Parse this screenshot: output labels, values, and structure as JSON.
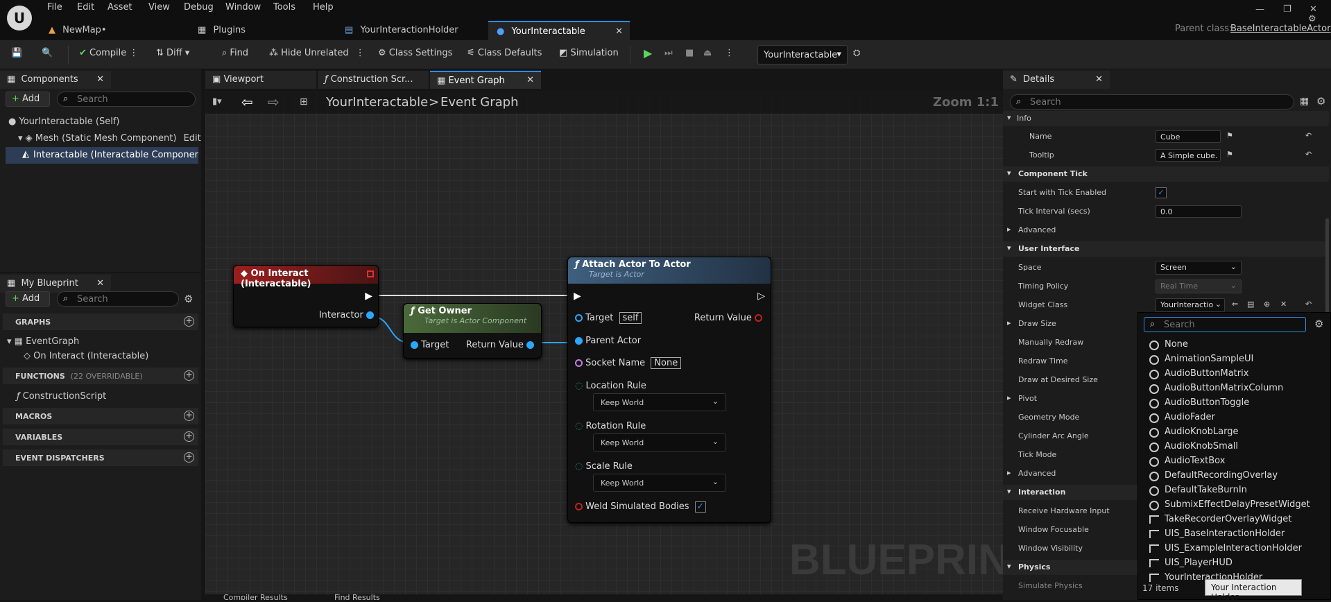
{
  "menu": [
    "File",
    "Edit",
    "Asset",
    "View",
    "Debug",
    "Window",
    "Tools",
    "Help"
  ],
  "tabs": {
    "newmap": "NewMap•",
    "plugins": "Plugins",
    "holder": "YourInteractionHolder",
    "interactable": "YourInteractable"
  },
  "parent": {
    "label": "Parent class:",
    "value": "BaseInteractableActor"
  },
  "toolbar": {
    "compile": "Compile",
    "diff": "Diff",
    "find": "Find",
    "hide": "Hide Unrelated",
    "class_settings": "Class Settings",
    "class_defaults": "Class Defaults",
    "simulation": "Simulation",
    "debug_object": "YourInteractable"
  },
  "components": {
    "tab": "Components",
    "add": "Add",
    "search": "Search",
    "self": "YourInteractable (Self)",
    "mesh": "Mesh (Static Mesh Component)",
    "edit_in": "Edit in",
    "interactable": "Interactable (Interactable Component)"
  },
  "myblueprint": {
    "tab": "My Blueprint",
    "add": "Add",
    "search": "Search",
    "graphs": "GRAPHS",
    "eventgraph": "EventGraph",
    "oninteract": "On Interact (Interactable)",
    "functions": "FUNCTIONS",
    "overridable": "(22 OVERRIDABLE)",
    "construction": "ConstructionScript",
    "macros": "MACROS",
    "variables": "VARIABLES",
    "dispatchers": "EVENT DISPATCHERS"
  },
  "graphtabs": {
    "viewport": "Viewport",
    "construction": "Construction Scr...",
    "eventgraph": "Event Graph"
  },
  "breadcrumb": {
    "bp": "YourInteractable",
    "sep": ">",
    "graph": "Event Graph",
    "zoom": "Zoom 1:1"
  },
  "watermark": "BLUEPRINT",
  "nodes": {
    "event": {
      "title": "On Interact (Interactable)",
      "pin": "Interactor"
    },
    "owner": {
      "title": "Get Owner",
      "sub": "Target is Actor Component",
      "target": "Target",
      "ret": "Return Value"
    },
    "attach": {
      "title": "Attach Actor To Actor",
      "sub": "Target is Actor",
      "target": "Target",
      "self": "self",
      "ret": "Return Value",
      "parent": "Parent Actor",
      "socket": "Socket Name",
      "socket_val": "None",
      "loc": "Location Rule",
      "rot": "Rotation Rule",
      "scale": "Scale Rule",
      "keep": "Keep World",
      "weld": "Weld Simulated Bodies"
    }
  },
  "bottomtabs": {
    "compiler": "Compiler Results",
    "find": "Find Results"
  },
  "details": {
    "tab": "Details",
    "search": "Search",
    "info": "Info",
    "name_l": "Name",
    "name_v": "Cube",
    "tip_l": "Tooltip",
    "tip_v": "A Simple cube.",
    "comptick": "Component Tick",
    "tick_en": "Start with Tick Enabled",
    "tick_int": "Tick Interval (secs)",
    "tick_int_v": "0.0",
    "advanced": "Advanced",
    "ui": "User Interface",
    "space": "Space",
    "space_v": "Screen",
    "timing": "Timing Policy",
    "timing_v": "Real Time",
    "widget": "Widget Class",
    "widget_v": "YourInteractio",
    "drawsize": "Draw Size",
    "manual": "Manually Redraw",
    "redraw": "Redraw Time",
    "desired": "Draw at Desired Size",
    "pivot": "Pivot",
    "geo": "Geometry Mode",
    "cyl": "Cylinder Arc Angle",
    "tickmode": "Tick Mode",
    "advanced2": "Advanced",
    "interaction": "Interaction",
    "hw": "Receive Hardware Input",
    "focus": "Window Focusable",
    "vis": "Window Visibility",
    "physics": "Physics",
    "simphys": "Simulate Physics"
  },
  "picker": {
    "search": "Search",
    "items": [
      "None",
      "AnimationSampleUI",
      "AudioButtonMatrix",
      "AudioButtonMatrixColumn",
      "AudioButtonToggle",
      "AudioFader",
      "AudioKnobLarge",
      "AudioKnobSmall",
      "AudioTextBox",
      "DefaultRecordingOverlay",
      "DefaultTakeBurnIn",
      "SubmixEffectDelayPresetWidget",
      "TakeRecorderOverlayWidget",
      "UIS_BaseInteractionHolder",
      "UIS_ExampleInteractionHolder",
      "UIS_PlayerHUD",
      "YourInteractionHolder"
    ],
    "count": "17 items",
    "tooltip": "Your Interaction Holder"
  }
}
